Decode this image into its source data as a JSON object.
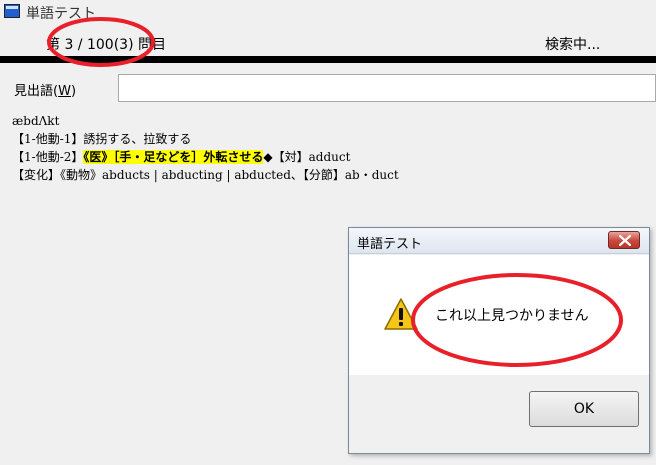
{
  "window": {
    "title": "単語テスト"
  },
  "status": {
    "counter": "第 3 / 100(3) 問目",
    "search_status": "検索中..."
  },
  "headword": {
    "label_prefix": "見出語(",
    "label_key": "W",
    "label_suffix": ")",
    "value": ""
  },
  "definition": {
    "pronunciation": "æbdΛkt",
    "line1": "【1-他動-1】誘拐する、拉致する",
    "line2_prefix": "【1-他動-2】",
    "line2_highlight": "《医》［手・足などを］外転させる",
    "line2_suffix": "◆【対】adduct",
    "line3": "【変化】《動物》abducts | abducting | abducted、【分節】ab・duct"
  },
  "dialog": {
    "title": "単語テスト",
    "message": "これ以上見つかりません",
    "ok_label": "OK",
    "icon": "warning-icon"
  },
  "annotations": {
    "color": "#e8202a"
  }
}
